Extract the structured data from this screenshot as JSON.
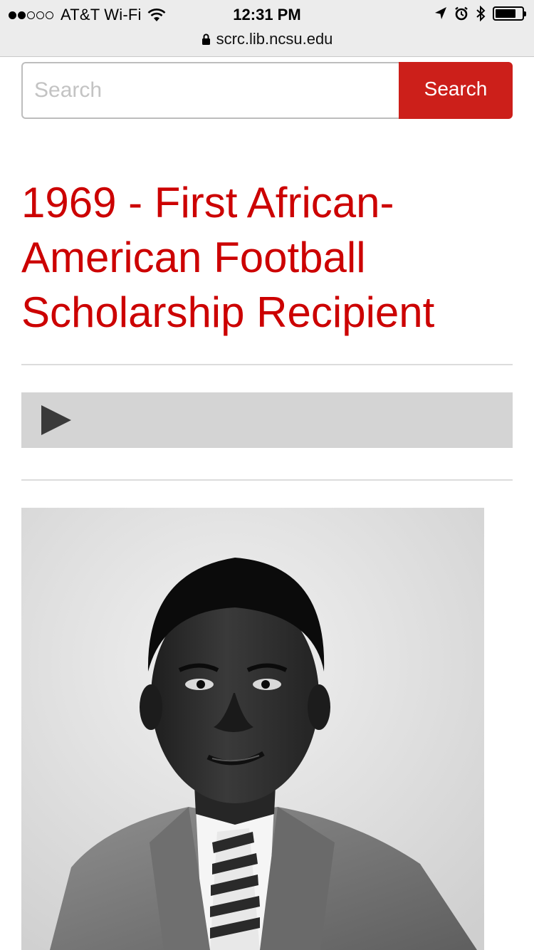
{
  "status_bar": {
    "carrier": "AT&T Wi-Fi",
    "time": "12:31 PM",
    "signal_bars_filled": 2,
    "signal_bars_total": 5,
    "battery_level": 0.78
  },
  "browser": {
    "url": "scrc.lib.ncsu.edu"
  },
  "search": {
    "placeholder": "Search",
    "button_label": "Search"
  },
  "page": {
    "title": "1969 - First African-American Football Scholarship Recipient"
  },
  "audio_player": {
    "state": "paused"
  },
  "colors": {
    "accent_red": "#cc0000",
    "button_red": "#cc1f1a",
    "player_bg": "#d4d4d4"
  },
  "icons": [
    "wifi-icon",
    "location-arrow-icon",
    "alarm-icon",
    "bluetooth-icon",
    "battery-icon",
    "lock-icon",
    "play-icon"
  ]
}
